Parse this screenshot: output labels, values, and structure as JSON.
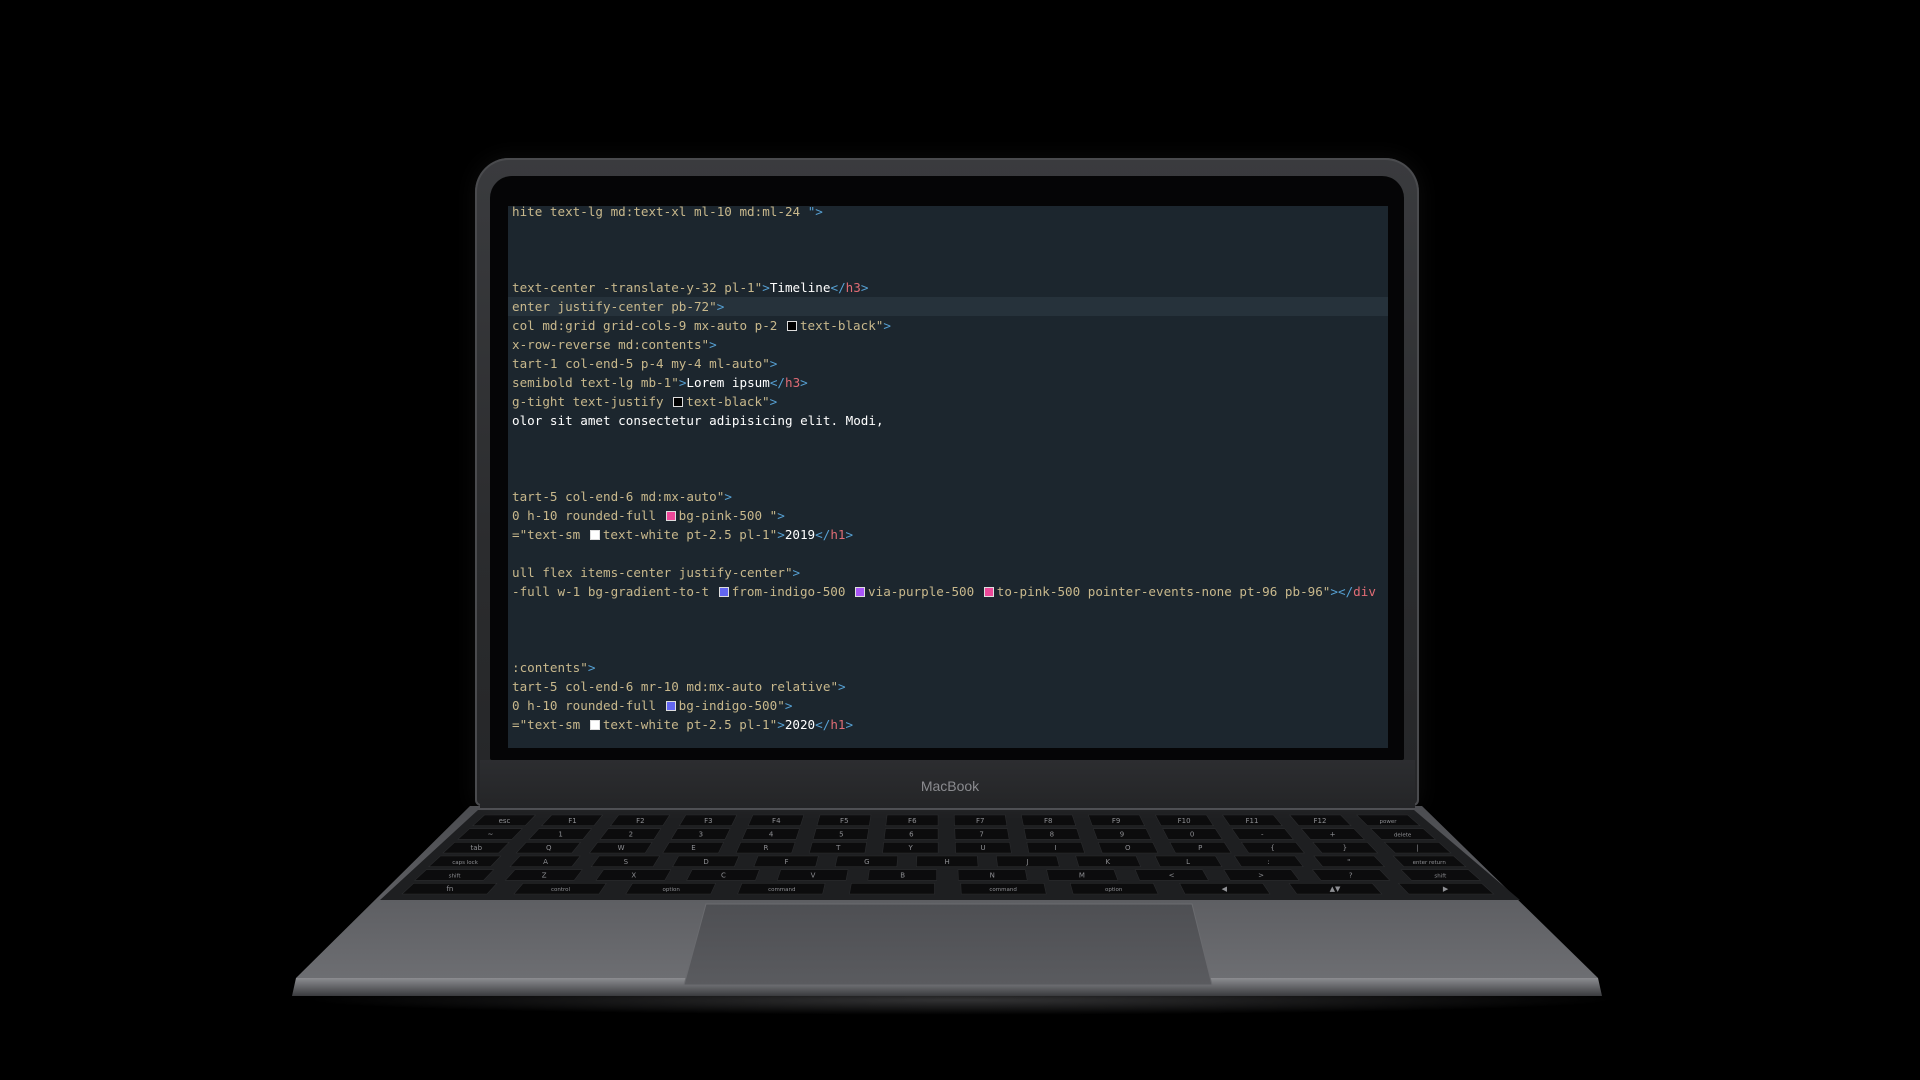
{
  "device": {
    "brand_label": "MacBook"
  },
  "editor": {
    "colors": {
      "background": "#1c262e",
      "text": "#c8b88c",
      "punct": "#56a0d3",
      "tag": "#e06c75",
      "content": "#ffffff"
    },
    "lines": [
      {
        "parts": [
          {
            "t": "hite text-lg md:text-xl ml-10 md:ml-24 ",
            "c": "tx-code"
          },
          {
            "t": "\">",
            "c": "pn"
          }
        ]
      },
      {
        "parts": []
      },
      {
        "parts": []
      },
      {
        "parts": []
      },
      {
        "parts": [
          {
            "t": "text-center -translate-y-32 pl-1\"",
            "c": "code"
          },
          {
            "t": ">",
            "c": "pn"
          },
          {
            "t": "Timeline",
            "c": "tx"
          },
          {
            "t": "</",
            "c": "pn"
          },
          {
            "t": "h3",
            "c": "tg"
          },
          {
            "t": ">",
            "c": "pn"
          }
        ]
      },
      {
        "active": true,
        "parts": [
          {
            "t": "enter justify-center pb-72\"",
            "c": "code"
          },
          {
            "t": ">",
            "c": "pn"
          }
        ]
      },
      {
        "parts": [
          {
            "t": "col md:grid grid-cols-9 mx-auto p-2 ",
            "c": "code"
          },
          {
            "swatch": "#000000"
          },
          {
            "t": "text-black\"",
            "c": "code"
          },
          {
            "t": ">",
            "c": "pn"
          }
        ]
      },
      {
        "parts": [
          {
            "t": "x-row-reverse md:contents\"",
            "c": "code"
          },
          {
            "t": ">",
            "c": "pn"
          }
        ]
      },
      {
        "parts": [
          {
            "t": "tart-1 col-end-5 p-4 my-4 ml-auto\"",
            "c": "code"
          },
          {
            "t": ">",
            "c": "pn"
          }
        ]
      },
      {
        "parts": [
          {
            "t": "semibold text-lg mb-1\"",
            "c": "code"
          },
          {
            "t": ">",
            "c": "pn"
          },
          {
            "t": "Lorem ipsum",
            "c": "tx"
          },
          {
            "t": "</",
            "c": "pn"
          },
          {
            "t": "h3",
            "c": "tg"
          },
          {
            "t": ">",
            "c": "pn"
          }
        ]
      },
      {
        "parts": [
          {
            "t": "g-tight text-justify ",
            "c": "code"
          },
          {
            "swatch": "#000000"
          },
          {
            "t": "text-black\"",
            "c": "code"
          },
          {
            "t": ">",
            "c": "pn"
          }
        ]
      },
      {
        "parts": [
          {
            "t": "olor sit amet consectetur adipisicing elit. Modi,",
            "c": "tx"
          }
        ]
      },
      {
        "parts": []
      },
      {
        "parts": []
      },
      {
        "parts": []
      },
      {
        "parts": [
          {
            "t": "tart-5 col-end-6 md:mx-auto\"",
            "c": "code"
          },
          {
            "t": ">",
            "c": "pn"
          }
        ]
      },
      {
        "parts": [
          {
            "t": "0 h-10 rounded-full ",
            "c": "code"
          },
          {
            "swatch": "#ec4899"
          },
          {
            "t": "bg-pink-500 \"",
            "c": "code"
          },
          {
            "t": ">",
            "c": "pn"
          }
        ]
      },
      {
        "parts": [
          {
            "t": "=\"text-sm ",
            "c": "code"
          },
          {
            "swatch": "#ffffff"
          },
          {
            "t": "text-white pt-2.5 pl-1\"",
            "c": "code"
          },
          {
            "t": ">",
            "c": "pn"
          },
          {
            "t": "2019",
            "c": "tx"
          },
          {
            "t": "</",
            "c": "pn"
          },
          {
            "t": "h1",
            "c": "tg"
          },
          {
            "t": ">",
            "c": "pn"
          }
        ]
      },
      {
        "parts": []
      },
      {
        "parts": [
          {
            "t": "ull flex items-center justify-center\"",
            "c": "code"
          },
          {
            "t": ">",
            "c": "pn"
          }
        ]
      },
      {
        "parts": [
          {
            "t": "-full w-1 bg-gradient-to-t ",
            "c": "code"
          },
          {
            "swatch": "#6366f1"
          },
          {
            "t": "from-indigo-500 ",
            "c": "code"
          },
          {
            "swatch": "#a855f7"
          },
          {
            "t": "via-purple-500 ",
            "c": "code"
          },
          {
            "swatch": "#ec4899"
          },
          {
            "t": "to-pink-500 pointer-events-none pt-96 pb-96\"",
            "c": "code"
          },
          {
            "t": "></",
            "c": "pn"
          },
          {
            "t": "div",
            "c": "tg"
          }
        ]
      },
      {
        "parts": []
      },
      {
        "parts": []
      },
      {
        "parts": []
      },
      {
        "parts": [
          {
            "t": ":contents\"",
            "c": "code"
          },
          {
            "t": ">",
            "c": "pn"
          }
        ]
      },
      {
        "parts": [
          {
            "t": "tart-5 col-end-6 mr-10 md:mx-auto relative\"",
            "c": "code"
          },
          {
            "t": ">",
            "c": "pn"
          }
        ]
      },
      {
        "parts": [
          {
            "t": "0 h-10 rounded-full ",
            "c": "code"
          },
          {
            "swatch": "#6366f1"
          },
          {
            "t": "bg-indigo-500\"",
            "c": "code"
          },
          {
            "t": ">",
            "c": "pn"
          }
        ]
      },
      {
        "parts": [
          {
            "t": "=\"text-sm ",
            "c": "code"
          },
          {
            "swatch": "#ffffff"
          },
          {
            "t": "text-white pt-2.5 pl-1\"",
            "c": "code"
          },
          {
            "t": ">",
            "c": "pn"
          },
          {
            "t": "2020",
            "c": "tx"
          },
          {
            "t": "</",
            "c": "pn"
          },
          {
            "t": "h1",
            "c": "tg"
          },
          {
            "t": ">",
            "c": "pn"
          }
        ]
      }
    ]
  },
  "keyboard": {
    "rows": [
      [
        "esc",
        "F1",
        "F2",
        "F3",
        "F4",
        "F5",
        "F6",
        "F7",
        "F8",
        "F9",
        "F10",
        "F11",
        "F12",
        "power"
      ],
      [
        "~",
        "1",
        "2",
        "3",
        "4",
        "5",
        "6",
        "7",
        "8",
        "9",
        "0",
        "-",
        "+",
        "delete"
      ],
      [
        "tab",
        "Q",
        "W",
        "E",
        "R",
        "T",
        "Y",
        "U",
        "I",
        "O",
        "P",
        "{",
        "}",
        "|"
      ],
      [
        "caps lock",
        "A",
        "S",
        "D",
        "F",
        "G",
        "H",
        "J",
        "K",
        "L",
        ":",
        "\"",
        "enter return"
      ],
      [
        "shift",
        "Z",
        "X",
        "C",
        "V",
        "B",
        "N",
        "M",
        "<",
        ">",
        "?",
        "shift"
      ],
      [
        "fn",
        "control",
        "option",
        "command",
        "",
        "command",
        "option",
        "◀",
        "▲▼",
        "▶"
      ]
    ]
  }
}
